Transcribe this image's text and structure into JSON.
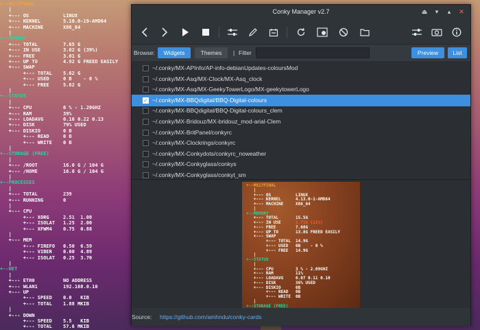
{
  "conky": {
    "lines": [
      {
        "k": "+--MX17FINAL",
        "v": "",
        "c": "hdr"
      },
      {
        "k": "   |",
        "v": "",
        "c": "tr"
      },
      {
        "k": "   +--- OS",
        "v": "LINUX",
        "c": "tr"
      },
      {
        "k": "   +--- KERNEL",
        "v": "5.10.0-19-AMD64",
        "c": "tr"
      },
      {
        "k": "   +--- MACHINE",
        "v": "X86_64",
        "c": "tr"
      },
      {
        "k": "   |",
        "v": "",
        "c": "tr"
      },
      {
        "k": "+--MEMORY",
        "v": "",
        "c": "sec"
      },
      {
        "k": "   +--- TOTAL",
        "v": "7.65 G",
        "c": "tr"
      },
      {
        "k": "   +--- IN USE",
        "v": "3.02 G (39%)",
        "c": "tr"
      },
      {
        "k": "   +--- FREE",
        "v": "3.01 G",
        "c": "tr"
      },
      {
        "k": "   +--- UP TO",
        "v": "4.92 G FREED EASILY",
        "c": "tr"
      },
      {
        "k": "   +--- SWAP",
        "v": "",
        "c": "tr"
      },
      {
        "k": "        +--- TOTAL",
        "v": "5.62 G",
        "c": "tr"
      },
      {
        "k": "        +--- USED",
        "v": "0 B    - 0 %",
        "c": "tr"
      },
      {
        "k": "        +--- FREE",
        "v": "5.62 G",
        "c": "tr"
      },
      {
        "k": "   |",
        "v": "",
        "c": "tr"
      },
      {
        "k": "+--STATUS",
        "v": "",
        "c": "sec"
      },
      {
        "k": "   |",
        "v": "",
        "c": "tr"
      },
      {
        "k": "   +--- CPU",
        "v": "6 % - 1.20GHZ",
        "c": "tr"
      },
      {
        "k": "   +--- RAM",
        "v": "39%",
        "c": "tr"
      },
      {
        "k": "   +--- LOADAVG",
        "v": "0.16 0.22 0.13",
        "c": "tr"
      },
      {
        "k": "   +--- DISK",
        "v": "79% USED",
        "c": "tr"
      },
      {
        "k": "   +--- DISKIO",
        "v": "0 B",
        "c": "tr"
      },
      {
        "k": "        +--- READ",
        "v": "0 B",
        "c": "tr"
      },
      {
        "k": "        +--- WRITE",
        "v": "0 B",
        "c": "tr"
      },
      {
        "k": "   |",
        "v": "",
        "c": "tr"
      },
      {
        "k": "+--STORAGE (FREE)",
        "v": "",
        "c": "sec"
      },
      {
        "k": "   |",
        "v": "",
        "c": "tr"
      },
      {
        "k": "   +--- /ROOT",
        "v": "16.0 G / 104 G",
        "c": "tr"
      },
      {
        "k": "   +--- /HOME",
        "v": "16.0 G / 104 G",
        "c": "tr"
      },
      {
        "k": "   |",
        "v": "",
        "c": "tr"
      },
      {
        "k": "+--PROCESSES",
        "v": "",
        "c": "sec"
      },
      {
        "k": "   |",
        "v": "",
        "c": "tr"
      },
      {
        "k": "   +--- TOTAL",
        "v": "239",
        "c": "tr"
      },
      {
        "k": "   +--- RUNNING",
        "v": "0",
        "c": "tr"
      },
      {
        "k": "   |",
        "v": "",
        "c": "tr"
      },
      {
        "k": "   +--- CPU",
        "v": "",
        "c": "tr"
      },
      {
        "k": "        +--- XORG",
        "v": "2.51  1.08",
        "c": "tr"
      },
      {
        "k": "        +--- ISOLAT",
        "v": "1.25  2.00",
        "c": "tr"
      },
      {
        "k": "        +--- XFWM4",
        "v": "0.75  0.88",
        "c": "tr"
      },
      {
        "k": "   |",
        "v": "",
        "c": "tr"
      },
      {
        "k": "   +--- MEM",
        "v": "",
        "c": "tr"
      },
      {
        "k": "        +--- FIREFO",
        "v": "0.50  6.59",
        "c": "tr"
      },
      {
        "k": "        +--- VIBER",
        "v": "0.00  4.89",
        "c": "tr"
      },
      {
        "k": "        +--- ISOLAT",
        "v": "0.25  3.70",
        "c": "tr"
      },
      {
        "k": "   |",
        "v": "",
        "c": "tr"
      },
      {
        "k": "+--NET",
        "v": "",
        "c": "sec"
      },
      {
        "k": "   |",
        "v": "",
        "c": "tr"
      },
      {
        "k": "   +--- ETH0",
        "v": "NO ADDRESS",
        "c": "tr"
      },
      {
        "k": "   +--- WLAN1",
        "v": "192.168.0.10",
        "c": "tr"
      },
      {
        "k": "   +--- UP",
        "v": "",
        "c": "tr"
      },
      {
        "k": "        +--- SPEED",
        "v": "0.0   KIB",
        "c": "tr"
      },
      {
        "k": "        +--- TOTAL",
        "v": "1.88 MKIB",
        "c": "tr"
      },
      {
        "k": "   |",
        "v": "",
        "c": "tr"
      },
      {
        "k": "   +--- DOWN",
        "v": "",
        "c": "tr"
      },
      {
        "k": "        +--- SPEED",
        "v": "5.5   KIB",
        "c": "tr"
      },
      {
        "k": "        +--- TOTAL",
        "v": "57.6 MKIB",
        "c": "tr"
      }
    ]
  },
  "window": {
    "title": "Conky Manager v2.7",
    "controls": {
      "keep_above": "⏏",
      "minimize": "▾",
      "maximize": "▴",
      "close": "✕"
    }
  },
  "toolbar": {
    "icons": [
      "back-icon",
      "forward-icon",
      "play-icon",
      "stop-icon",
      "settings-sliders-icon",
      "edit-pencil-icon",
      "widget-icon",
      "refresh-icon",
      "preview-generate-icon",
      "kill-icon",
      "folder-icon",
      "options-icon",
      "screenshot-icon",
      "info-icon"
    ]
  },
  "browse": {
    "label": "Browse:",
    "widgets": "Widgets",
    "themes": "Themes",
    "sep": "|",
    "filter_label": "Filter",
    "filter_value": "",
    "preview": "Preview",
    "list": "List"
  },
  "items": [
    {
      "path": "~/.conky/MX-APInfo/AP-info-debianUpdates-coloursMod",
      "checked": false
    },
    {
      "path": "~/.conky/MX-Asq/MX-Clock/MX-Asq_clock",
      "checked": false
    },
    {
      "path": "~/.conky/MX-Asq/MX-GeekyTowerLogo/MX-geekytowerLogo",
      "checked": false
    },
    {
      "path": "~/.conky/MX-BBQdigital/BBQ-Digital-colours",
      "checked": true
    },
    {
      "path": "~/.conky/MX-BBQdigital/BBQ-Digital-colours_clem",
      "checked": false
    },
    {
      "path": "~/.conky/MX-Bridouz/MX-bridouz_mod-arial-Clem",
      "checked": false
    },
    {
      "path": "~/.conky/MX-BritPanel/conkyrc",
      "checked": false
    },
    {
      "path": "~/.conky/MX-Clockrings/conkyrc",
      "checked": false
    },
    {
      "path": "~/.conky/MX-Conkydots/conkyrc_noweather",
      "checked": false
    },
    {
      "path": "~/.conky/MX-Conkyglass/conkys",
      "checked": false
    },
    {
      "path": "~/.conky/MX-Conkyglass/conkyt_sm",
      "checked": false
    }
  ],
  "preview_lines": [
    {
      "k": "+--MX17FINAL",
      "v": "",
      "c": "hdr"
    },
    {
      "k": "   |",
      "v": "",
      "c": "tr"
    },
    {
      "k": "   +--- OS",
      "v": "LINUX",
      "c": "tr"
    },
    {
      "k": "   +--- KERNEL",
      "v": "4.13.0-1-AMD64",
      "c": "tr"
    },
    {
      "k": "   +--- MACHINE",
      "v": "X86_64",
      "c": "tr"
    },
    {
      "k": "   |",
      "v": "",
      "c": "tr"
    },
    {
      "k": "+--MEMORY",
      "v": "",
      "c": "sec"
    },
    {
      "k": "   +--- TOTAL",
      "v": "15.5G",
      "c": "tr"
    },
    {
      "k": "   +--- IN USE",
      "v": "1.71G (11%)",
      "c": "red"
    },
    {
      "k": "   +--- FREE",
      "v": "7.08G",
      "c": "tr"
    },
    {
      "k": "   +--- UP TO",
      "v": "13.8G FREED EASILY",
      "c": "tr"
    },
    {
      "k": "   +--- SWAP",
      "v": "",
      "c": "tr"
    },
    {
      "k": "        +--- TOTAL",
      "v": "14.9G",
      "c": "tr"
    },
    {
      "k": "        +--- USED",
      "v": "0B    - 0 %",
      "c": "tr"
    },
    {
      "k": "        +--- FREE",
      "v": "14.9G",
      "c": "tr"
    },
    {
      "k": "   |",
      "v": "",
      "c": "tr"
    },
    {
      "k": "+--STATUS",
      "v": "",
      "c": "sec"
    },
    {
      "k": "   |",
      "v": "",
      "c": "tr"
    },
    {
      "k": "   +--- CPU",
      "v": "3 % - 2.09GHZ",
      "c": "tr"
    },
    {
      "k": "   +--- RAM",
      "v": "11%",
      "c": "tr"
    },
    {
      "k": "   +--- LOADAVG",
      "v": "0.07 0.11 0.10",
      "c": "tr"
    },
    {
      "k": "   +--- DISK",
      "v": "36% USED",
      "c": "tr"
    },
    {
      "k": "   +--- DISKIO",
      "v": "0B",
      "c": "tr"
    },
    {
      "k": "        +--- READ",
      "v": "0B",
      "c": "tr"
    },
    {
      "k": "        +--- WRITE",
      "v": "0B",
      "c": "tr"
    },
    {
      "k": "   |",
      "v": "",
      "c": "tr"
    },
    {
      "k": "+--STORAGE (FREE)",
      "v": "",
      "c": "sec"
    }
  ],
  "source": {
    "label": "Source:",
    "url": "https://github.com/amhndu/conky-cards"
  },
  "colors": {
    "accent": "#3d8fe0",
    "conky_header": "#f3a23a",
    "conky_section": "#2fd3a0",
    "close": "#ff6b3d"
  }
}
